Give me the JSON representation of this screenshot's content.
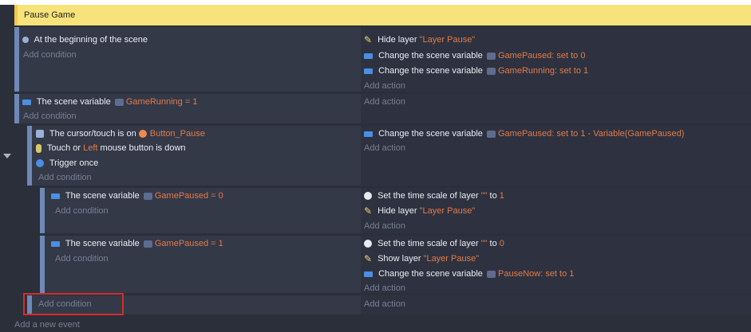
{
  "group_title": "Pause Game",
  "events": [
    {
      "conditions": [
        {
          "icon": "scene-start-icon",
          "text": "At the beginning of the scene"
        }
      ],
      "add_condition": "Add condition",
      "actions": [
        {
          "icon": "hide-layer-icon",
          "prefix": "Hide layer ",
          "value": "\"Layer Pause\""
        },
        {
          "icon": "scene-variable-icon",
          "prefix": "Change the scene variable ",
          "var": "GamePaused",
          "suffix": ": set to 0"
        },
        {
          "icon": "scene-variable-icon",
          "prefix": "Change the scene variable ",
          "var": "GameRunning",
          "suffix": ": set to 1"
        }
      ],
      "add_action": "Add action"
    },
    {
      "conditions": [
        {
          "icon": "scene-variable-icon",
          "prefix": "The scene variable ",
          "var": "GameRunning",
          "suffix": " = 1"
        }
      ],
      "add_condition": "Add condition",
      "actions": [],
      "add_action": "Add action"
    },
    {
      "conditions": [
        {
          "icon": "cursor-icon",
          "prefix": "The cursor/touch is on ",
          "obj": "Button_Pause"
        },
        {
          "icon": "mouse-icon",
          "prefix": "Touch or ",
          "mid": "Left",
          "suffix": " mouse button is down"
        },
        {
          "icon": "trigger-once-icon",
          "text": "Trigger once"
        }
      ],
      "add_condition": "Add condition",
      "actions": [
        {
          "icon": "scene-variable-icon",
          "prefix": "Change the scene variable ",
          "var": "GamePaused",
          "suffix": ": set to 1 - Variable(GamePaused)"
        }
      ],
      "add_action": "Add action"
    },
    {
      "conditions": [
        {
          "icon": "scene-variable-icon",
          "prefix": "The scene variable ",
          "var": "GamePaused",
          "suffix": " = 0"
        }
      ],
      "add_condition": "Add condition",
      "actions": [
        {
          "icon": "time-scale-icon",
          "prefix": "Set the time scale of layer ",
          "layer": "\"\"",
          "to": " to ",
          "value": "1"
        },
        {
          "icon": "hide-layer-icon",
          "prefix": "Hide layer ",
          "value": "\"Layer Pause\""
        }
      ],
      "add_action": "Add action"
    },
    {
      "conditions": [
        {
          "icon": "scene-variable-icon",
          "prefix": "The scene variable ",
          "var": "GamePaused",
          "suffix": " = 1"
        }
      ],
      "add_condition": "Add condition",
      "actions": [
        {
          "icon": "time-scale-icon",
          "prefix": "Set the time scale of layer ",
          "layer": "\"\"",
          "to": " to ",
          "value": "0"
        },
        {
          "icon": "show-layer-icon",
          "prefix": "Show layer ",
          "value": "\"Layer Pause\""
        },
        {
          "icon": "scene-variable-icon",
          "prefix": "Change the scene variable ",
          "var": "PauseNow",
          "suffix": ": set to 1"
        }
      ],
      "add_action": "Add action"
    }
  ],
  "footer": {
    "add_condition": "Add condition",
    "add_action": "Add action",
    "add_new_event": "Add a new event"
  },
  "colors": {
    "group_bg": "#f8e27a",
    "variable_name": "#e27a48",
    "highlight_box": "#d62b2b"
  }
}
